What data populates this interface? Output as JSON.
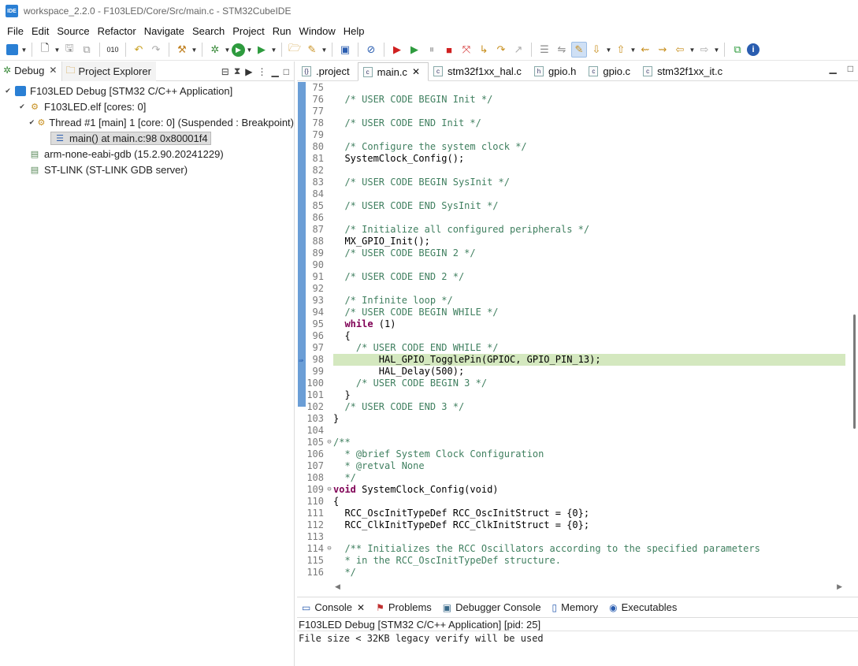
{
  "window": {
    "title": "workspace_2.2.0 - F103LED/Core/Src/main.c - STM32CubeIDE",
    "app_icon_text": "IDE"
  },
  "menu": [
    "File",
    "Edit",
    "Source",
    "Refactor",
    "Navigate",
    "Search",
    "Project",
    "Run",
    "Window",
    "Help"
  ],
  "left_pane": {
    "tabs": [
      {
        "label": "Debug",
        "icon": "debug-bug-icon",
        "active": true
      },
      {
        "label": "Project Explorer",
        "icon": "project-explorer-icon",
        "active": false
      }
    ],
    "tree": [
      {
        "label": "F103LED Debug [STM32 C/C++ Application]",
        "icon": "ide-launch-icon",
        "level": 0,
        "expanded": true
      },
      {
        "label": "F103LED.elf [cores: 0]",
        "icon": "elf-process-icon",
        "level": 1,
        "expanded": true
      },
      {
        "label": "Thread #1 [main] 1 [core: 0] (Suspended : Breakpoint)",
        "icon": "thread-suspended-icon",
        "level": 2,
        "expanded": true
      },
      {
        "label": "main() at main.c:98 0x80001f4",
        "icon": "stack-frame-icon",
        "level": 3,
        "selected": true
      },
      {
        "label": "arm-none-eabi-gdb (15.2.90.20241229)",
        "icon": "gdb-process-icon",
        "level": 1
      },
      {
        "label": "ST-LINK (ST-LINK GDB server)",
        "icon": "stlink-process-icon",
        "level": 1
      }
    ]
  },
  "editor": {
    "tabs": [
      {
        "label": ".project",
        "icon": "xml-file-icon",
        "active": false
      },
      {
        "label": "main.c",
        "icon": "c-file-icon",
        "active": true
      },
      {
        "label": "stm32f1xx_hal.c",
        "icon": "c-file-icon",
        "active": false
      },
      {
        "label": "gpio.h",
        "icon": "h-file-icon",
        "active": false
      },
      {
        "label": "gpio.c",
        "icon": "c-file-icon",
        "active": false
      },
      {
        "label": "stm32f1xx_it.c",
        "icon": "c-file-icon",
        "active": false
      }
    ],
    "current_line": 98,
    "lines": [
      {
        "n": 75,
        "t": ""
      },
      {
        "n": 76,
        "t": "  /* USER CODE BEGIN Init */",
        "cls": "cm"
      },
      {
        "n": 77,
        "t": ""
      },
      {
        "n": 78,
        "t": "  /* USER CODE END Init */",
        "cls": "cm"
      },
      {
        "n": 79,
        "t": ""
      },
      {
        "n": 80,
        "t": "  /* Configure the system clock */",
        "cls": "cm"
      },
      {
        "n": 81,
        "t": "  SystemClock_Config();"
      },
      {
        "n": 82,
        "t": ""
      },
      {
        "n": 83,
        "t": "  /* USER CODE BEGIN SysInit */",
        "cls": "cm"
      },
      {
        "n": 84,
        "t": ""
      },
      {
        "n": 85,
        "t": "  /* USER CODE END SysInit */",
        "cls": "cm"
      },
      {
        "n": 86,
        "t": ""
      },
      {
        "n": 87,
        "t": "  /* Initialize all configured peripherals */",
        "cls": "cm"
      },
      {
        "n": 88,
        "t": "  MX_GPIO_Init();"
      },
      {
        "n": 89,
        "t": "  /* USER CODE BEGIN 2 */",
        "cls": "cm"
      },
      {
        "n": 90,
        "t": ""
      },
      {
        "n": 91,
        "t": "  /* USER CODE END 2 */",
        "cls": "cm"
      },
      {
        "n": 92,
        "t": ""
      },
      {
        "n": 93,
        "t": "  /* Infinite loop */",
        "cls": "cm"
      },
      {
        "n": 94,
        "t": "  /* USER CODE BEGIN WHILE */",
        "cls": "cm"
      },
      {
        "n": 95,
        "t": "  while (1)",
        "kw": "while"
      },
      {
        "n": 96,
        "t": "  {"
      },
      {
        "n": 97,
        "t": "    /* USER CODE END WHILE */",
        "cls": "cm"
      },
      {
        "n": 98,
        "t": "        HAL_GPIO_TogglePin(GPIOC, GPIO_PIN_13);"
      },
      {
        "n": 99,
        "t": "        HAL_Delay(500);"
      },
      {
        "n": 100,
        "t": "    /* USER CODE BEGIN 3 */",
        "cls": "cm"
      },
      {
        "n": 101,
        "t": "  }"
      },
      {
        "n": 102,
        "t": "  /* USER CODE END 3 */",
        "cls": "cm"
      },
      {
        "n": 103,
        "t": "}"
      },
      {
        "n": 104,
        "t": ""
      },
      {
        "n": 105,
        "t": "/**",
        "cls": "cm",
        "fold": true
      },
      {
        "n": 106,
        "t": "  * @brief System Clock Configuration",
        "cls": "cm"
      },
      {
        "n": 107,
        "t": "  * @retval None",
        "cls": "cm"
      },
      {
        "n": 108,
        "t": "  */",
        "cls": "cm"
      },
      {
        "n": 109,
        "t": "void SystemClock_Config(void)",
        "fold": true,
        "kw": "void"
      },
      {
        "n": 110,
        "t": "{"
      },
      {
        "n": 111,
        "t": "  RCC_OscInitTypeDef RCC_OscInitStruct = {0};"
      },
      {
        "n": 112,
        "t": "  RCC_ClkInitTypeDef RCC_ClkInitStruct = {0};"
      },
      {
        "n": 113,
        "t": ""
      },
      {
        "n": 114,
        "t": "  /** Initializes the RCC Oscillators according to the specified parameters",
        "cls": "cm",
        "fold": true
      },
      {
        "n": 115,
        "t": "  * in the RCC_OscInitTypeDef structure.",
        "cls": "cm"
      },
      {
        "n": 116,
        "t": "  */",
        "cls": "cm"
      }
    ]
  },
  "console": {
    "tabs": [
      {
        "label": "Console",
        "icon": "console-icon",
        "active": true
      },
      {
        "label": "Problems",
        "icon": "problems-icon"
      },
      {
        "label": "Debugger Console",
        "icon": "debugger-console-icon"
      },
      {
        "label": "Memory",
        "icon": "memory-icon"
      },
      {
        "label": "Executables",
        "icon": "executables-icon"
      }
    ],
    "title": "F103LED Debug [STM32 C/C++ Application]  [pid: 25]",
    "output": "File size < 32KB legacy verify will be used"
  },
  "colors": {
    "accent": "#2a7fd4",
    "current_line": "#d4e8bf",
    "comment": "#3f7f5f",
    "keyword": "#7f0055",
    "gutter": "#6b9ed6"
  }
}
